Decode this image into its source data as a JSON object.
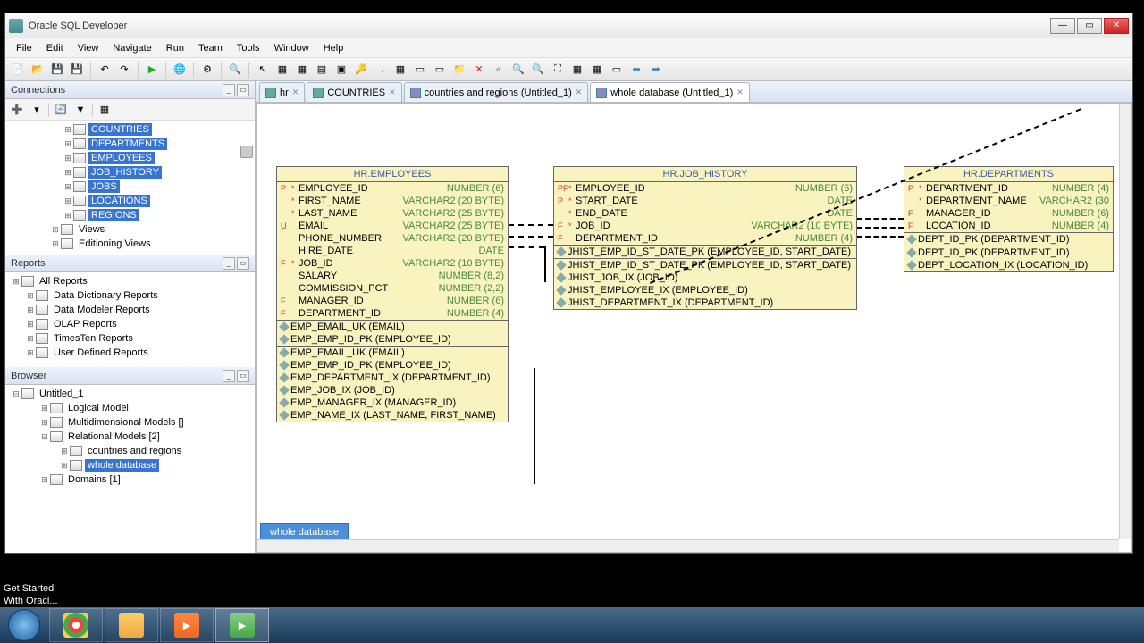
{
  "titlebar": {
    "title": "Oracle SQL Developer"
  },
  "menu": [
    "File",
    "Edit",
    "View",
    "Navigate",
    "Run",
    "Team",
    "Tools",
    "Window",
    "Help"
  ],
  "panels": {
    "connections": "Connections",
    "reports": "Reports",
    "browser": "Browser"
  },
  "conn_tree": [
    {
      "label": "COUNTRIES",
      "sel": true,
      "pad": 62
    },
    {
      "label": "DEPARTMENTS",
      "sel": true,
      "pad": 62
    },
    {
      "label": "EMPLOYEES",
      "sel": true,
      "pad": 62
    },
    {
      "label": "JOB_HISTORY",
      "sel": true,
      "pad": 62
    },
    {
      "label": "JOBS",
      "sel": true,
      "pad": 62
    },
    {
      "label": "LOCATIONS",
      "sel": true,
      "pad": 62
    },
    {
      "label": "REGIONS",
      "sel": true,
      "pad": 62
    },
    {
      "label": "Views",
      "sel": false,
      "pad": 48,
      "exp": "+"
    },
    {
      "label": "Editioning Views",
      "sel": false,
      "pad": 48,
      "exp": "+"
    }
  ],
  "reports_tree": [
    {
      "label": "All Reports",
      "pad": 4
    },
    {
      "label": "Data Dictionary Reports",
      "pad": 20,
      "exp": "+"
    },
    {
      "label": "Data Modeler Reports",
      "pad": 20,
      "exp": "+"
    },
    {
      "label": "OLAP Reports",
      "pad": 20,
      "exp": "+"
    },
    {
      "label": "TimesTen Reports",
      "pad": 20,
      "exp": "+"
    },
    {
      "label": "User Defined Reports",
      "pad": 20,
      "exp": "+"
    }
  ],
  "browser_tree": [
    {
      "label": "Untitled_1",
      "pad": 4,
      "exp": "-"
    },
    {
      "label": "Logical Model",
      "pad": 36
    },
    {
      "label": "Multidimensional Models []",
      "pad": 36
    },
    {
      "label": "Relational Models [2]",
      "pad": 36,
      "exp": "-"
    },
    {
      "label": "countries and regions",
      "pad": 58
    },
    {
      "label": "whole database",
      "pad": 58,
      "sel": true
    },
    {
      "label": "Domains [1]",
      "pad": 36,
      "exp": "+"
    }
  ],
  "tabs": [
    {
      "label": "hr",
      "icon": "#6a9"
    },
    {
      "label": "COUNTRIES",
      "icon": "#6a9"
    },
    {
      "label": "countries and regions (Untitled_1)",
      "icon": "#88c"
    },
    {
      "label": "whole database (Untitled_1)",
      "icon": "#88c",
      "active": true
    }
  ],
  "bottom_tab": "whole database",
  "entities": {
    "emp": {
      "title": "HR.EMPLOYEES",
      "cols": [
        {
          "flag": "P",
          "star": "*",
          "name": "EMPLOYEE_ID",
          "type": "NUMBER (6)"
        },
        {
          "flag": "",
          "star": "*",
          "name": "FIRST_NAME",
          "type": "VARCHAR2 (20 BYTE)"
        },
        {
          "flag": "",
          "star": "*",
          "name": "LAST_NAME",
          "type": "VARCHAR2 (25 BYTE)"
        },
        {
          "flag": "U",
          "star": "",
          "name": "EMAIL",
          "type": "VARCHAR2 (25 BYTE)"
        },
        {
          "flag": "",
          "star": "",
          "name": "PHONE_NUMBER",
          "type": "VARCHAR2 (20 BYTE)"
        },
        {
          "flag": "",
          "star": "",
          "name": "HIRE_DATE",
          "type": "DATE"
        },
        {
          "flag": "F",
          "star": "*",
          "name": "JOB_ID",
          "type": "VARCHAR2 (10 BYTE)"
        },
        {
          "flag": "",
          "star": "",
          "name": "SALARY",
          "type": "NUMBER (8,2)"
        },
        {
          "flag": "",
          "star": "",
          "name": "COMMISSION_PCT",
          "type": "NUMBER (2,2)"
        },
        {
          "flag": "F",
          "star": "",
          "name": "MANAGER_ID",
          "type": "NUMBER (6)"
        },
        {
          "flag": "F",
          "star": "",
          "name": "DEPARTMENT_ID",
          "type": "NUMBER (4)"
        }
      ],
      "idx1": [
        "EMP_EMAIL_UK (EMAIL)",
        "EMP_EMP_ID_PK (EMPLOYEE_ID)"
      ],
      "idx2": [
        "EMP_EMAIL_UK (EMAIL)",
        "EMP_EMP_ID_PK (EMPLOYEE_ID)",
        "EMP_DEPARTMENT_IX (DEPARTMENT_ID)",
        "EMP_JOB_IX (JOB_ID)",
        "EMP_MANAGER_IX (MANAGER_ID)",
        "EMP_NAME_IX (LAST_NAME, FIRST_NAME)"
      ]
    },
    "jh": {
      "title": "HR.JOB_HISTORY",
      "cols": [
        {
          "flag": "PF",
          "star": "*",
          "name": "EMPLOYEE_ID",
          "type": "NUMBER (6)"
        },
        {
          "flag": "P",
          "star": "*",
          "name": "START_DATE",
          "type": "DATE"
        },
        {
          "flag": "",
          "star": "*",
          "name": "END_DATE",
          "type": "DATE"
        },
        {
          "flag": "F",
          "star": "*",
          "name": "JOB_ID",
          "type": "VARCHAR2 (10 BYTE)"
        },
        {
          "flag": "F",
          "star": "",
          "name": "DEPARTMENT_ID",
          "type": "NUMBER (4)"
        }
      ],
      "idx1": [
        "JHIST_EMP_ID_ST_DATE_PK (EMPLOYEE_ID, START_DATE)"
      ],
      "idx2": [
        "JHIST_EMP_ID_ST_DATE_PK (EMPLOYEE_ID, START_DATE)",
        "JHIST_JOB_IX (JOB_ID)",
        "JHIST_EMPLOYEE_IX (EMPLOYEE_ID)",
        "JHIST_DEPARTMENT_IX (DEPARTMENT_ID)"
      ]
    },
    "dept": {
      "title": "HR.DEPARTMENTS",
      "cols": [
        {
          "flag": "P",
          "star": "*",
          "name": "DEPARTMENT_ID",
          "type": "NUMBER (4)"
        },
        {
          "flag": "",
          "star": "*",
          "name": "DEPARTMENT_NAME",
          "type": "VARCHAR2 (30"
        },
        {
          "flag": "F",
          "star": "",
          "name": "MANAGER_ID",
          "type": "NUMBER (6)"
        },
        {
          "flag": "F",
          "star": "",
          "name": "LOCATION_ID",
          "type": "NUMBER (4)"
        }
      ],
      "idx1": [
        "DEPT_ID_PK (DEPARTMENT_ID)"
      ],
      "idx2": [
        "DEPT_ID_PK (DEPARTMENT_ID)",
        "DEPT_LOCATION_IX (LOCATION_ID)"
      ]
    }
  },
  "status": {
    "line1": "Get Started",
    "line2": "With Oracl..."
  }
}
